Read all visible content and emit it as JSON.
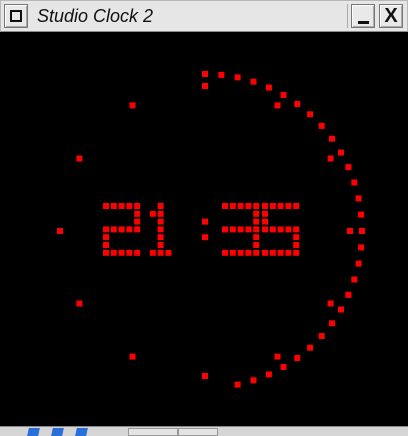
{
  "window": {
    "title": "Studio Clock 2",
    "menu_icon": "window-menu-icon",
    "minimize_icon": "minimize-icon",
    "close_icon": "close-icon",
    "close_glyph": "X"
  },
  "clock": {
    "time": "21:35",
    "hours": "21",
    "minutes": "35",
    "seconds_elapsed": 29,
    "led_color": "#ff0000",
    "background": "#000000"
  },
  "taskbar": {
    "items": [
      "taskbar-item-1",
      "taskbar-item-2",
      "taskbar-item-3"
    ]
  }
}
